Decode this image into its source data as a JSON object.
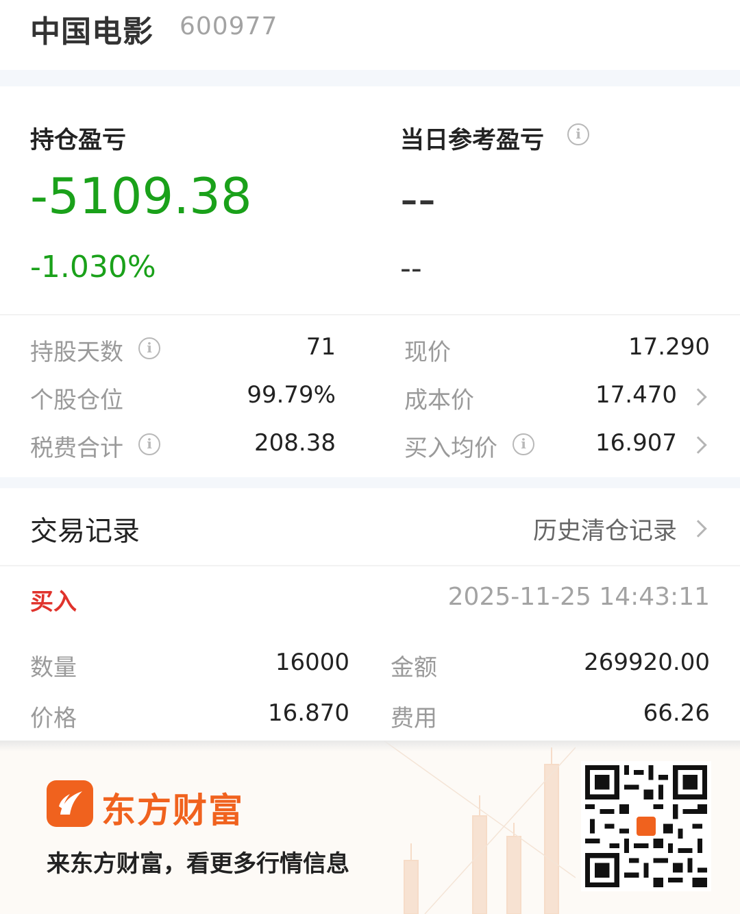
{
  "header": {
    "stock_name": "中国电影",
    "stock_code": "600977"
  },
  "pnl": {
    "holding_label": "持仓盈亏",
    "holding_value": "-5109.38",
    "holding_pct": "-1.030%",
    "daily_label": "当日参考盈亏",
    "daily_value": "--",
    "daily_pct": "--",
    "loss_color": "#1aa11a"
  },
  "stats": {
    "hold_days_label": "持股天数",
    "hold_days_value": "71",
    "current_price_label": "现价",
    "current_price_value": "17.290",
    "position_label": "个股仓位",
    "position_value": "99.79%",
    "cost_label": "成本价",
    "cost_value": "17.470",
    "fee_label": "税费合计",
    "fee_value": "208.38",
    "avg_buy_label": "买入均价",
    "avg_buy_value": "16.907"
  },
  "trades": {
    "title": "交易记录",
    "history_link": "历史清仓记录",
    "records": [
      {
        "type": "买入",
        "time": "2025-11-25 14:43:11",
        "qty_label": "数量",
        "qty": "16000",
        "amount_label": "金额",
        "amount": "269920.00",
        "price_label": "价格",
        "price": "16.870",
        "fee_label": "费用",
        "fee": "66.26"
      }
    ]
  },
  "footer": {
    "brand": "东方财富",
    "slogan": "来东方财富，看更多行情信息",
    "brand_color": "#f0621e"
  },
  "icons": {
    "info": "i"
  }
}
